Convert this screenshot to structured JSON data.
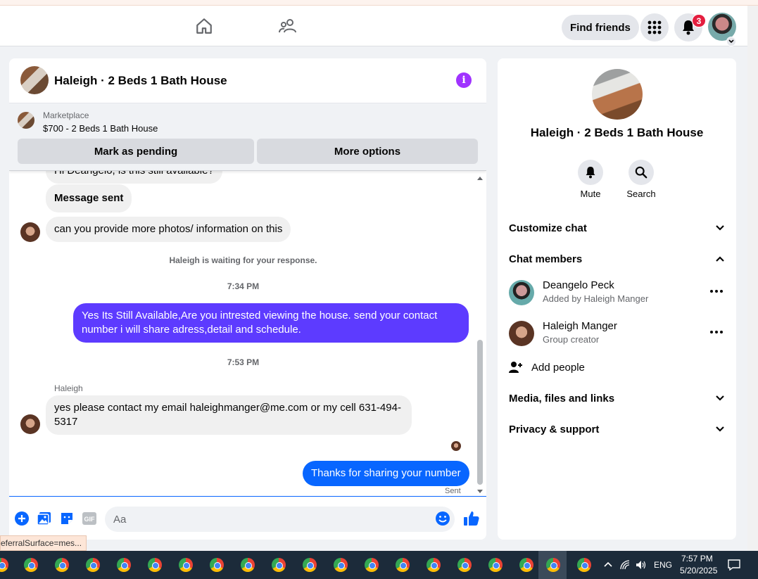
{
  "header": {
    "find_friends_label": "Find friends",
    "notification_count": "3"
  },
  "chat": {
    "title": "Haleigh · 2 Beds 1 Bath House",
    "marketplace_label": "Marketplace",
    "listing_line": "$700 - 2 Beds 1 Bath House",
    "mark_pending_label": "Mark as pending",
    "more_options_label": "More options",
    "messages": {
      "partial_top": "Hi Deangelo, is this still available?",
      "message_sent": "Message sent",
      "photos_request": "can you provide more photos/ information on this",
      "waiting_note": "Haleigh is waiting for your response.",
      "time_1": "7:34 PM",
      "reply_1": "Yes Its Still Available,Are you intrested viewing the house. send your contact number i will share adress,detail and schedule.",
      "time_2": "7:53 PM",
      "sender_name": "Haleigh",
      "contact_msg": "yes please contact my email haleighmanger@me.com or my cell 631-494-5317",
      "reply_2": "Thanks for sharing your number",
      "sent_status": "Sent"
    },
    "composer_placeholder": "Aa"
  },
  "details": {
    "title": "Haleigh · 2 Beds 1 Bath House",
    "mute_label": "Mute",
    "search_label": "Search",
    "customize_chat": "Customize chat",
    "chat_members": "Chat members",
    "members": [
      {
        "name": "Deangelo Peck",
        "sub": "Added by Haleigh Manger"
      },
      {
        "name": "Haleigh Manger",
        "sub": "Group creator"
      }
    ],
    "add_people": "Add people",
    "media_files_links": "Media, files and links",
    "privacy_support": "Privacy & support"
  },
  "tooltip": "eferralSurface=mes...",
  "taskbar": {
    "language": "ENG",
    "time": "7:57 PM",
    "date": "5/20/2025"
  },
  "colors": {
    "brand_blue": "#0866ff",
    "outgoing_purple": "#5d3bff",
    "info_purple": "#a033ff",
    "badge_red": "#e41e3f"
  }
}
